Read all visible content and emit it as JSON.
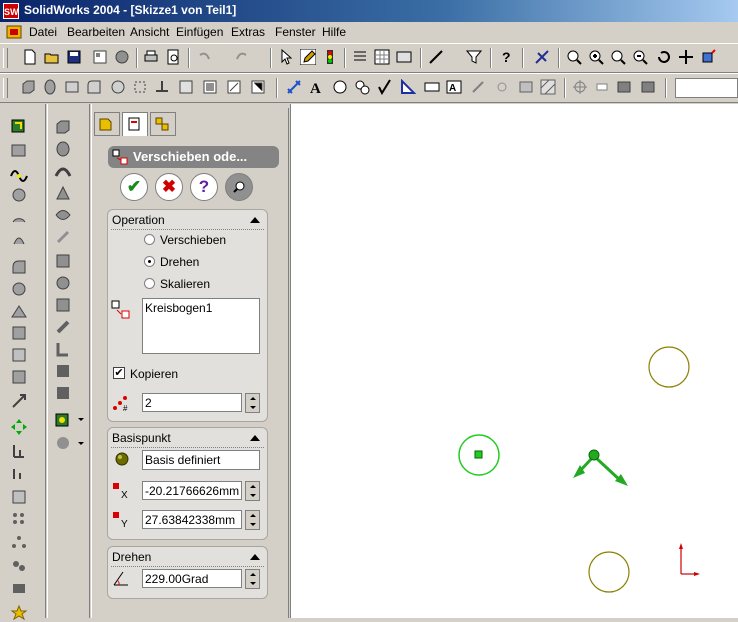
{
  "window": {
    "title": "SolidWorks 2004 - [Skizze1 von Teil1]",
    "app_icon_text": "SW"
  },
  "menu": [
    "Datei",
    "Bearbeiten",
    "Ansicht",
    "Einfügen",
    "Extras",
    "Fenster",
    "Hilfe"
  ],
  "property_manager": {
    "title": "Verschieben ode...",
    "ok_label": "✔",
    "cancel_label": "✖",
    "help_label": "?",
    "operation": {
      "header": "Operation",
      "options": [
        "Verschieben",
        "Drehen",
        "Skalieren"
      ],
      "selected": "Drehen",
      "list_items": [
        "Kreisbogen1"
      ],
      "copy_label": "Kopieren",
      "copy_checked": true,
      "copies": "2"
    },
    "basepoint": {
      "header": "Basispunkt",
      "base_value": "Basis definiert",
      "x_value": "-20.21766626mm",
      "y_value": "27.63842338mm"
    },
    "rotate": {
      "header": "Drehen",
      "angle_value": "229.00Grad"
    }
  },
  "colors": {
    "title_start": "#0a246a",
    "title_end": "#a6caf0",
    "selected_circle": "#22cc22",
    "circle": "#8b8000"
  }
}
